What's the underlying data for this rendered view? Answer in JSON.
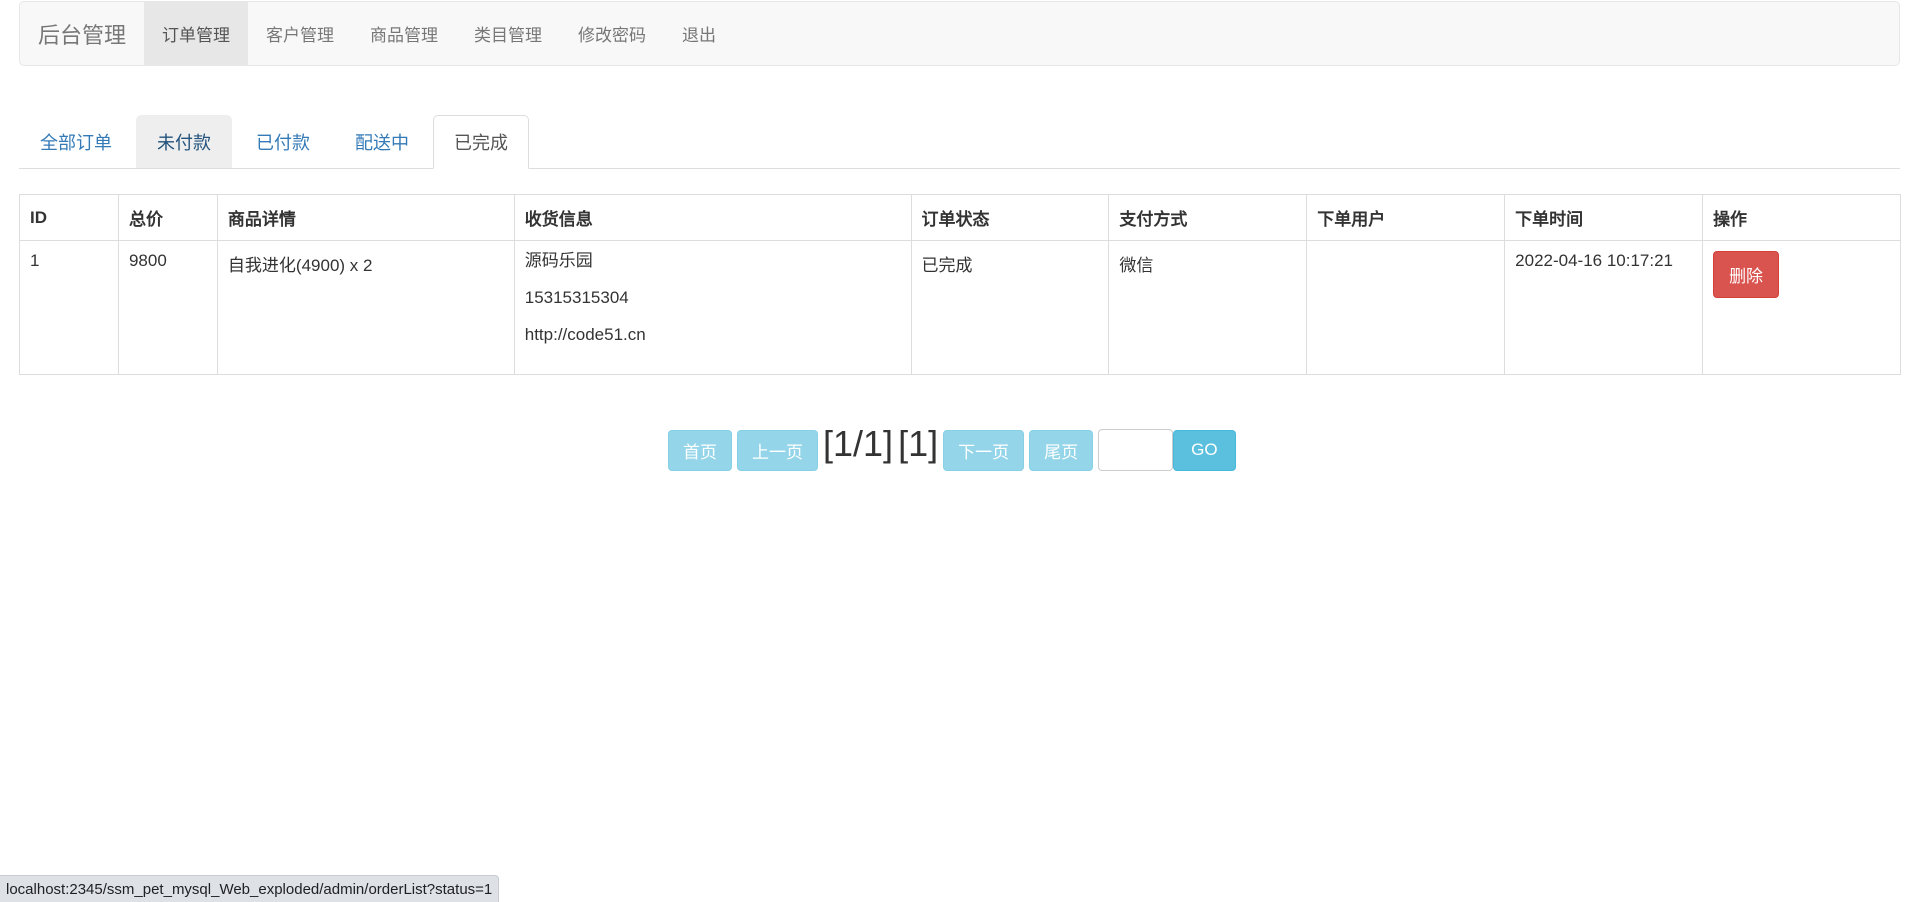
{
  "navbar": {
    "brand": "后台管理",
    "items": [
      {
        "label": "订单管理",
        "active": true
      },
      {
        "label": "客户管理"
      },
      {
        "label": "商品管理"
      },
      {
        "label": "类目管理"
      },
      {
        "label": "修改密码"
      },
      {
        "label": "退出"
      }
    ]
  },
  "tabs": [
    {
      "label": "全部订单"
    },
    {
      "label": "未付款",
      "state": "hover"
    },
    {
      "label": "已付款"
    },
    {
      "label": "配送中"
    },
    {
      "label": "已完成",
      "state": "active"
    }
  ],
  "table": {
    "headers": [
      "ID",
      "总价",
      "商品详情",
      "收货信息",
      "订单状态",
      "支付方式",
      "下单用户",
      "下单时间",
      "操作"
    ],
    "rows": [
      {
        "id": "1",
        "total": "9800",
        "detail": "自我进化(4900) x 2",
        "name": "源码乐园",
        "phone": "15315315304",
        "address": "http://code51.cn",
        "status": "已完成",
        "payment": "微信",
        "user": "",
        "time": "2022-04-16 10:17:21",
        "action": "删除"
      }
    ]
  },
  "pagination": {
    "first": "首页",
    "prev": "上一页",
    "page_info": "[1/1]",
    "current": "[1]",
    "next": "下一页",
    "last": "尾页",
    "input_value": "",
    "go": "GO"
  },
  "statusbar": {
    "url": "localhost:2345/ssm_pet_mysql_Web_exploded/admin/orderList?status=1"
  },
  "colors": {
    "link": "#337ab7",
    "danger": "#d9534f",
    "info": "#5bc0de",
    "navbar_bg": "#f8f8f8"
  }
}
